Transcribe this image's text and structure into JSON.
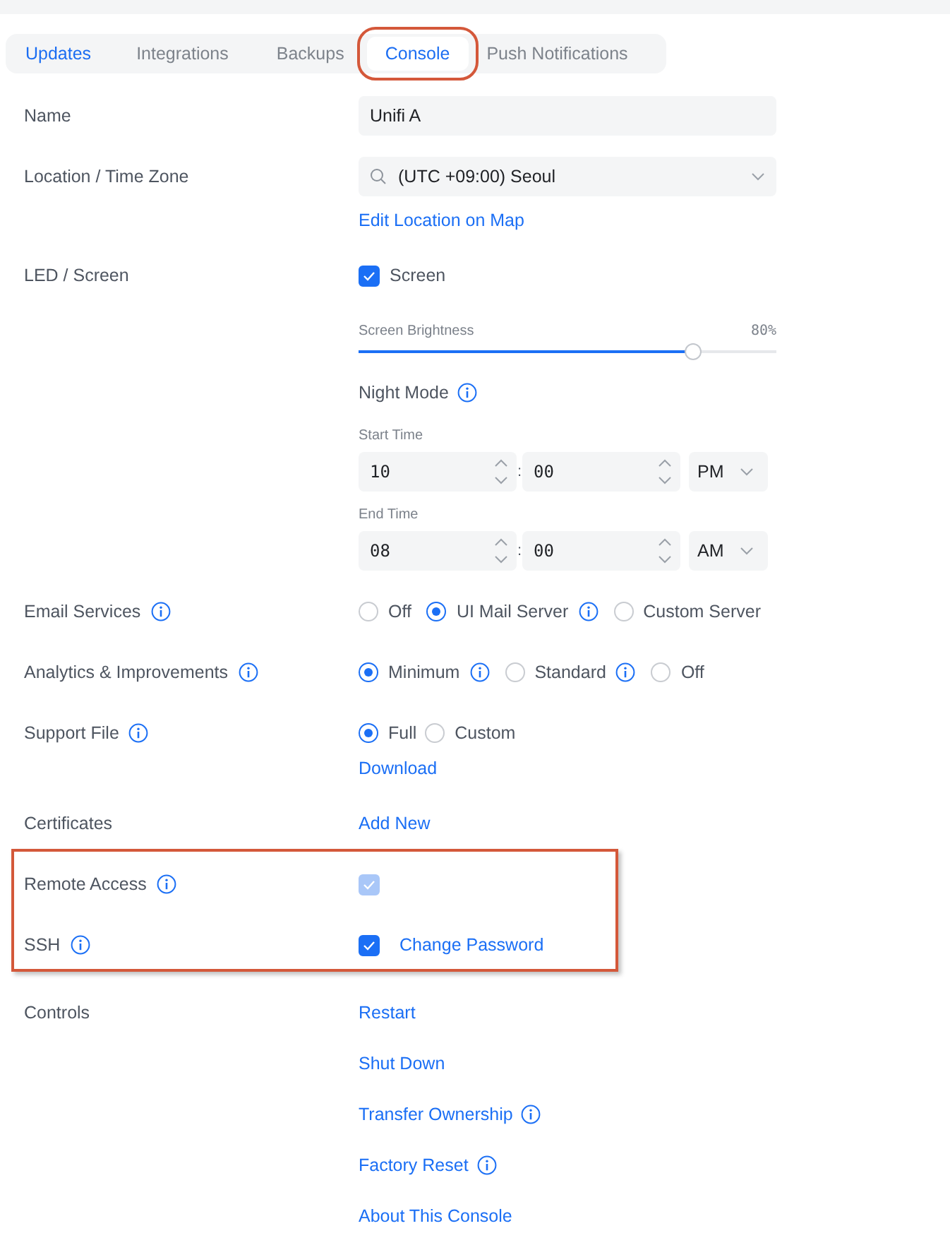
{
  "tabs": [
    {
      "label": "Updates",
      "selected": false,
      "highlighted": false,
      "color": "#1c6ef2"
    },
    {
      "label": "Integrations",
      "selected": false,
      "highlighted": false,
      "color": "#7d838b"
    },
    {
      "label": "Backups",
      "selected": false,
      "highlighted": false,
      "color": "#7d838b"
    },
    {
      "label": "Console",
      "selected": true,
      "highlighted": true,
      "color": "#1c6ef2"
    },
    {
      "label": "Push Notifications",
      "selected": false,
      "highlighted": false,
      "color": "#7d838b"
    }
  ],
  "rows": [
    {
      "kind": "text",
      "label": "Name",
      "info": false,
      "highlighted": false,
      "value": "Unifi A"
    },
    {
      "kind": "select",
      "label": "Location / Time Zone",
      "info": false,
      "highlighted": false,
      "value": "(UTC +09:00) Seoul",
      "link": "Edit Location on Map"
    },
    {
      "kind": "led",
      "label": "LED / Screen",
      "info": false,
      "highlighted": false,
      "checkbox": {
        "label": "Screen",
        "checked": true
      },
      "slider": {
        "label": "Screen Brightness",
        "reading": "80%",
        "level": 0.8
      },
      "night_mode": {
        "label": "Night Mode",
        "info": true,
        "times": [
          {
            "label": "Start Time",
            "hour": "10",
            "separator": ":",
            "minute": "00",
            "period": "PM"
          },
          {
            "label": "End Time",
            "hour": "08",
            "separator": ":",
            "minute": "00",
            "period": "AM"
          }
        ]
      }
    },
    {
      "kind": "radio",
      "label": "Email Services",
      "info": true,
      "highlighted": false,
      "options": [
        {
          "label": "Off",
          "selected": false,
          "info": false
        },
        {
          "label": "UI Mail Server",
          "selected": true,
          "info": true
        },
        {
          "label": "Custom Server",
          "selected": false,
          "info": false
        }
      ]
    },
    {
      "kind": "radio",
      "label": "Analytics & Improvements",
      "info": true,
      "highlighted": false,
      "options": [
        {
          "label": "Minimum",
          "selected": true,
          "info": true
        },
        {
          "label": "Standard",
          "selected": false,
          "info": true
        },
        {
          "label": "Off",
          "selected": false,
          "info": false
        }
      ]
    },
    {
      "kind": "radio",
      "label": "Support File",
      "info": true,
      "highlighted": false,
      "options": [
        {
          "label": "Full",
          "selected": true,
          "info": false
        },
        {
          "label": "Custom",
          "selected": false,
          "info": false
        }
      ],
      "link": "Download"
    },
    {
      "kind": "links",
      "label": "Certificates",
      "info": false,
      "highlighted": false,
      "links": [
        {
          "label": "Add New",
          "info": false
        }
      ]
    },
    {
      "kind": "checkbox",
      "label": "Remote Access",
      "info": true,
      "highlighted": true,
      "checked": true,
      "disabled": true
    },
    {
      "kind": "checkbox",
      "label": "SSH",
      "info": true,
      "highlighted": true,
      "checked": true,
      "disabled": false,
      "link": "Change Password"
    },
    {
      "kind": "links",
      "label": "Controls",
      "info": false,
      "highlighted": false,
      "links": [
        {
          "label": "Restart",
          "info": false
        },
        {
          "label": "Shut Down",
          "info": false
        },
        {
          "label": "Transfer Ownership",
          "info": true
        },
        {
          "label": "Factory Reset",
          "info": true
        },
        {
          "label": "About This Console",
          "info": false
        }
      ]
    }
  ]
}
